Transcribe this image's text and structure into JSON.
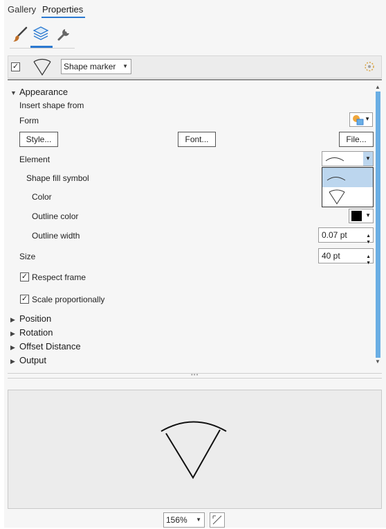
{
  "tabs": [
    "Gallery",
    "Properties"
  ],
  "active_tab": "Properties",
  "toolbar_icons": [
    "paintbrush-icon",
    "layers-icon",
    "wrench-icon"
  ],
  "layer": {
    "enabled": true,
    "marker_type": "Shape marker"
  },
  "appearance": {
    "header": "Appearance",
    "insert_shape_from": "Insert shape from",
    "form_label": "Form",
    "style_button": "Style...",
    "font_button": "Font...",
    "file_button": "File...",
    "element_label": "Element",
    "shape_fill_symbol": "Shape fill symbol",
    "color_label": "Color",
    "outline_color_label": "Outline color",
    "outline_color": "#000000",
    "outline_width_label": "Outline width",
    "outline_width_value": "0.07 pt",
    "size_label": "Size",
    "size_value": "40 pt",
    "respect_frame_label": "Respect frame",
    "respect_frame_checked": true,
    "scale_label": "Scale proportionally",
    "scale_checked": true
  },
  "element_options": [
    "arc",
    "sector"
  ],
  "element_selected": "arc",
  "sections": [
    "Position",
    "Rotation",
    "Offset Distance",
    "Output"
  ],
  "zoom": "156%",
  "accent_color": "#2b79d1"
}
